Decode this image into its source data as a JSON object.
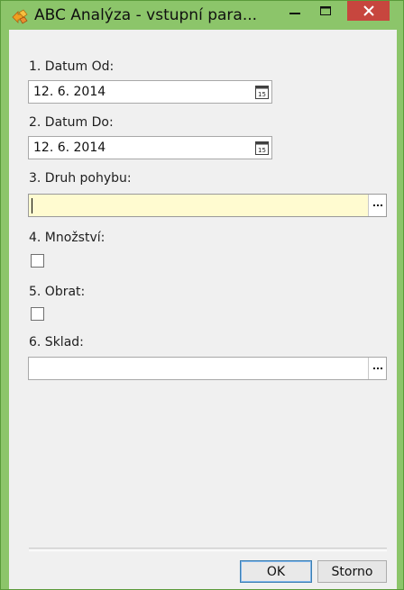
{
  "window": {
    "title": "ABC Analýza - vstupní para...",
    "app_icon": "abc-analysis-icon"
  },
  "form": {
    "datum_od": {
      "label": "1. Datum Od:",
      "value": "12. 6. 2014"
    },
    "datum_do": {
      "label": "2. Datum Do:",
      "value": "12. 6. 2014"
    },
    "druh_pohybu": {
      "label": "3. Druh pohybu:",
      "value": ""
    },
    "mnozstvi": {
      "label": "4. Množství:",
      "checked": false
    },
    "obrat": {
      "label": "5. Obrat:",
      "checked": false
    },
    "sklad": {
      "label": "6. Sklad:",
      "value": ""
    }
  },
  "buttons": {
    "ok": "OK",
    "cancel": "Storno",
    "browse": "..."
  },
  "colors": {
    "titlebar": "#8cc56a",
    "close_button": "#c7463e",
    "active_field": "#fffbd0"
  }
}
